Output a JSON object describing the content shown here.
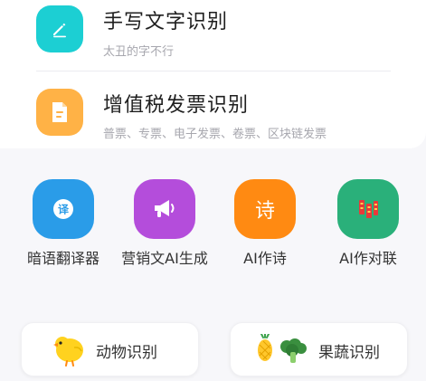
{
  "features": [
    {
      "title": "手写文字识别",
      "desc": "太丑的字不行",
      "icon": "edit-pencil-icon",
      "color": "#1ccfd3"
    },
    {
      "title": "增值税发票识别",
      "desc": "普票、专票、电子发票、卷票、区块链发票",
      "icon": "document-icon",
      "color": "#ffb246"
    }
  ],
  "tools": [
    {
      "label": "暗语翻译器",
      "icon": "translate-icon",
      "glyph": "译",
      "color": "#2a9ce8"
    },
    {
      "label": "营销文AI生成",
      "icon": "megaphone-icon",
      "color": "#b44ddb"
    },
    {
      "label": "AI作诗",
      "icon": "poem-icon",
      "glyph": "诗",
      "color": "#ff8a12"
    },
    {
      "label": "AI作对联",
      "icon": "couplet-icon",
      "color": "#2ab07a"
    }
  ],
  "bottom_buttons": [
    {
      "label": "动物识别",
      "icon": "chick-icon"
    },
    {
      "label": "果蔬识别",
      "icon": "fruit-vegetable-icon"
    }
  ]
}
